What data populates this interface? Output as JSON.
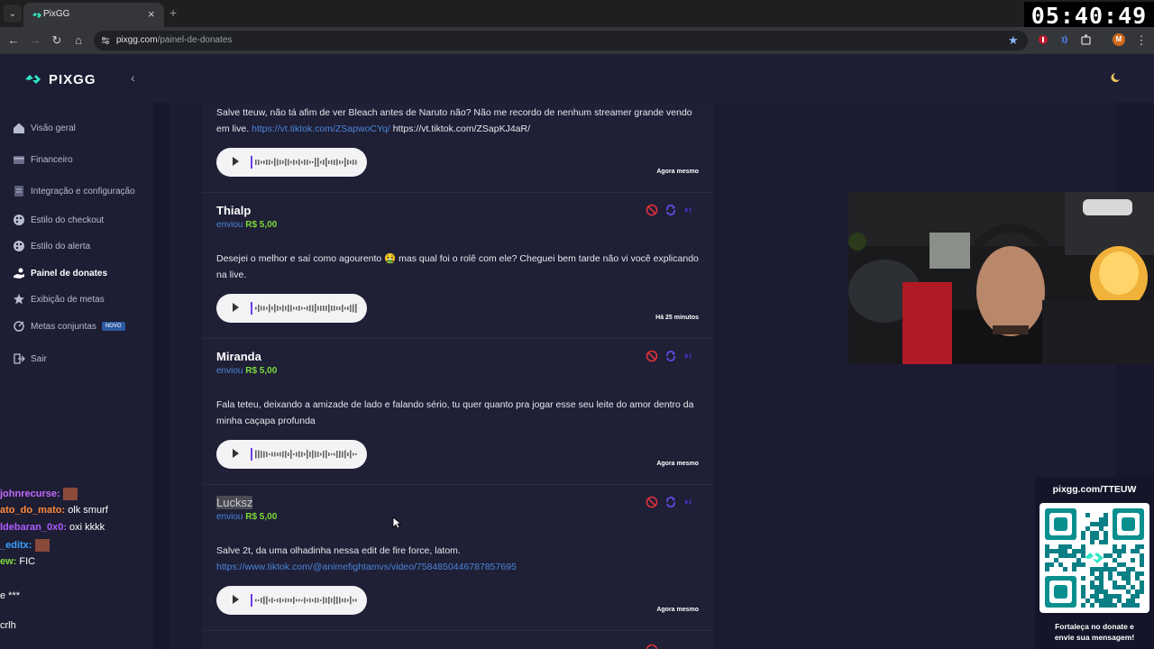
{
  "browser": {
    "tab_title": "PixGG",
    "url_domain": "pixgg.com",
    "url_path": "/painel-de-donates",
    "clock": "05:40:49",
    "profile_initial": "M"
  },
  "sidebar": {
    "logo_text": "PIXGG",
    "items": [
      {
        "label": "Visão geral",
        "icon": "home-icon"
      },
      {
        "label": "Financeiro",
        "icon": "wallet-icon"
      },
      {
        "label": "Integração e configuração",
        "icon": "document-icon"
      },
      {
        "label": "Estilo do checkout",
        "icon": "palette-icon"
      },
      {
        "label": "Estilo do alerta",
        "icon": "palette-icon"
      },
      {
        "label": "Painel de donates",
        "icon": "hand-coin-icon"
      },
      {
        "label": "Exibição de metas",
        "icon": "star-icon"
      },
      {
        "label": "Metas conjuntas",
        "icon": "target-icon",
        "badge": "NOVO"
      },
      {
        "label": "Sair",
        "icon": "logout-icon"
      }
    ],
    "active_index": 5
  },
  "feed": {
    "top_card": {
      "message_plain": "Salve tteuw, não tá afim de ver Bleach antes de Naruto não? Não me recordo de nenhum streamer grande vendo em live.",
      "link": "https://vt.tiktok.com/ZSapwoCYq/",
      "trailing_text": "https://vt.tiktok.com/ZSapKJ4aR/",
      "time": "Agora mesmo"
    },
    "cards": [
      {
        "name": "Thialp",
        "sent_label": "enviou",
        "amount": "R$ 5,00",
        "message": "Desejei o melhor e saí como agourento 🤮 mas qual foi o rolê com ele? Cheguei bem tarde não vi você explicando na live.",
        "time": "Há 25 minutos"
      },
      {
        "name": "Miranda",
        "sent_label": "enviou",
        "amount": "R$ 5,00",
        "message": "Fala teteu, deixando a amizade de lado e falando sério, tu quer quanto pra jogar esse seu leite do amor dentro da minha caçapa profunda",
        "time": "Agora mesmo"
      },
      {
        "name": "Lucksz",
        "sent_label": "enviou",
        "amount": "R$ 5,00",
        "message": "Salve 2t, da uma olhadinha nessa edit de fire force, latom.",
        "link": "https://www.tiktok.com/@animefightamvs/video/7584850446787857695",
        "time": "Agora mesmo"
      }
    ]
  },
  "chat": [
    {
      "user": "johnrecurse:",
      "text": "",
      "color": "#c46bff"
    },
    {
      "user": "ato_do_mato:",
      "text": "olk smurf",
      "color": "#ff8a3d"
    },
    {
      "user": "ldebaran_0x0:",
      "text": "oxi kkkk",
      "color": "#b05cff"
    },
    {
      "user": "_editx:",
      "text": "",
      "color": "#3aa0ff"
    },
    {
      "user": "ew:",
      "text": "FIC",
      "color": "#7ddb3a"
    },
    {
      "user": "",
      "text": "e ***",
      "color": "#ffffff"
    },
    {
      "user": "",
      "text": "crlh",
      "color": "#ffffff"
    }
  ],
  "qr_panel": {
    "title": "pixgg.com/TTEUW",
    "caption_line1": "Fortaleça no donate e",
    "caption_line2": "envie sua mensagem!"
  },
  "colors": {
    "accent_green": "#7ddb3a",
    "link_blue": "#4a86d8",
    "logo_teal": "#2ee6c5",
    "danger_red": "#e0313a"
  }
}
